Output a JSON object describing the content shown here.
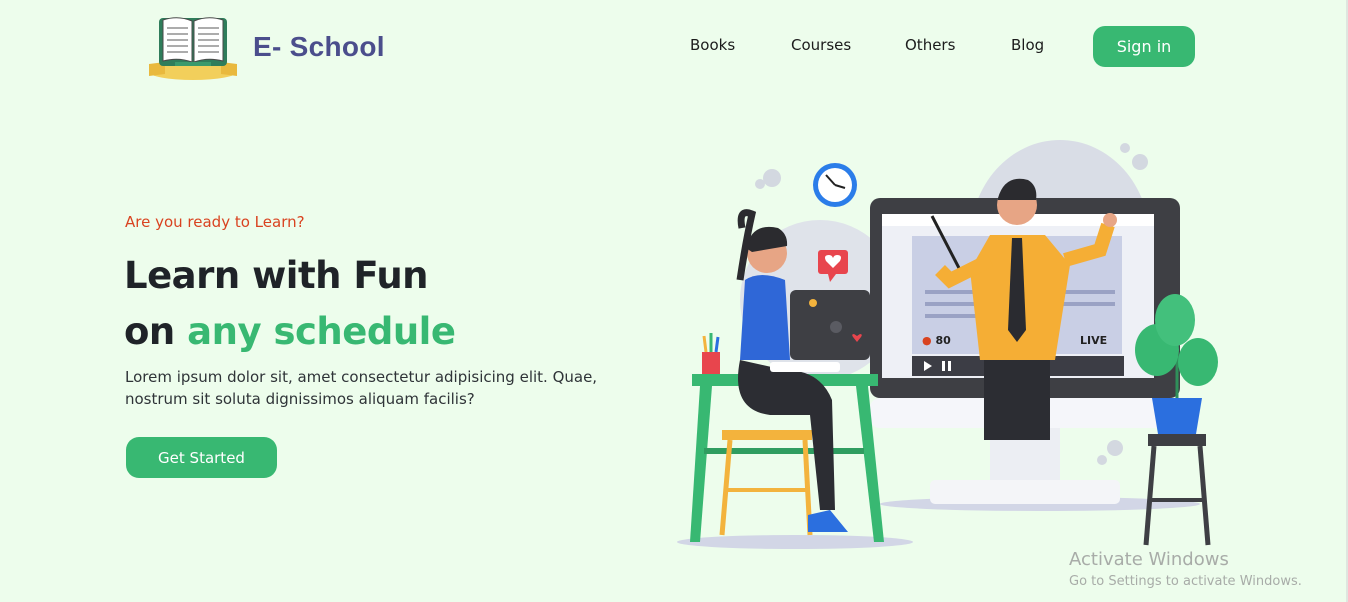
{
  "brand": {
    "name": "E- School",
    "logo_icon": "open-book-icon"
  },
  "nav": {
    "links": [
      "Books",
      "Courses",
      "Others",
      "Blog"
    ],
    "signin_label": "Sign in"
  },
  "hero": {
    "eyebrow": "Are you ready to Learn?",
    "title_line1": "Learn with Fun",
    "title_line2_prefix": "on",
    "title_line2_accent": "any schedule",
    "description": "Lorem ipsum dolor sit, amet consectetur adipisicing elit. Quae, nostrum sit soluta dignissimos aliquam facilis?",
    "cta_label": "Get Started"
  },
  "illustration": {
    "viewer_count": "80",
    "live_label": "LIVE"
  },
  "windows_watermark": {
    "title": "Activate Windows",
    "subtitle": "Go to Settings to activate Windows."
  },
  "colors": {
    "background": "#edfdec",
    "accent_green": "#38b872",
    "brand_purple": "#4b4e8c",
    "eyebrow_red": "#d94320"
  }
}
